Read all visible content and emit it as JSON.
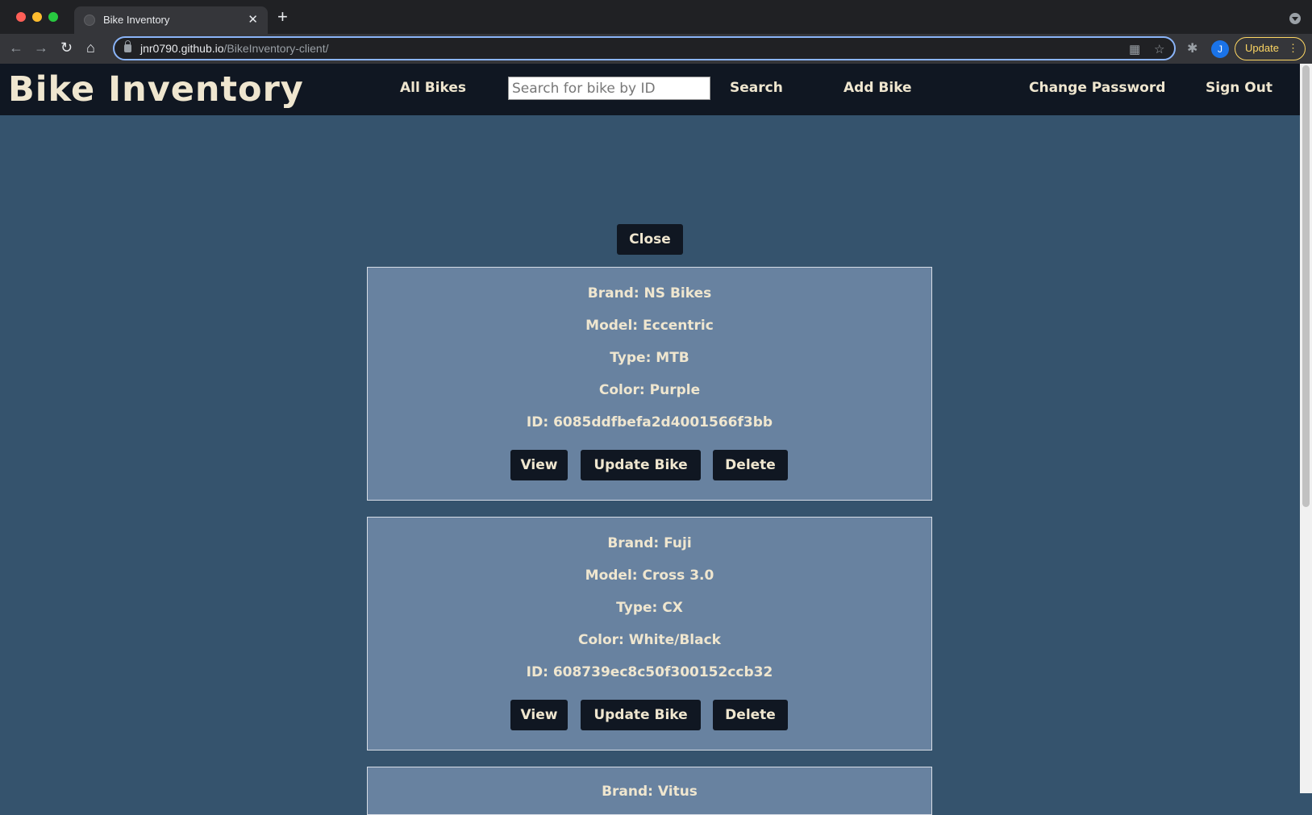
{
  "browser": {
    "tab_title": "Bike Inventory",
    "tab_close": "✕",
    "new_tab": "+",
    "url_host": "jnr0790.github.io",
    "url_path": "/BikeInventory-client/",
    "avatar_letter": "J",
    "update_label": "Update",
    "update_dots": "⋮"
  },
  "navbar": {
    "brand": "Bike Inventory",
    "all_bikes": "All Bikes",
    "search_placeholder": "Search for bike by ID",
    "search_label": "Search",
    "add_bike": "Add Bike",
    "change_password": "Change Password",
    "sign_out": "Sign Out"
  },
  "content": {
    "close_label": "Close",
    "bikes": [
      {
        "brand": "Brand: NS Bikes",
        "model": "Model: Eccentric",
        "type": "Type: MTB",
        "color": "Color: Purple",
        "id": "ID: 6085ddfbefa2d4001566f3bb",
        "view": "View",
        "update": "Update Bike",
        "delete": "Delete"
      },
      {
        "brand": "Brand: Fuji",
        "model": "Model: Cross 3.0",
        "type": "Type: CX",
        "color": "Color: White/Black",
        "id": "ID: 608739ec8c50f300152ccb32",
        "view": "View",
        "update": "Update Bike",
        "delete": "Delete"
      },
      {
        "brand": "Brand: Vitus"
      }
    ]
  },
  "colors": {
    "page_bg": "#35536d",
    "navbar_bg": "#101722",
    "card_bg": "#6882a0",
    "text_cream": "#efe6cf"
  }
}
